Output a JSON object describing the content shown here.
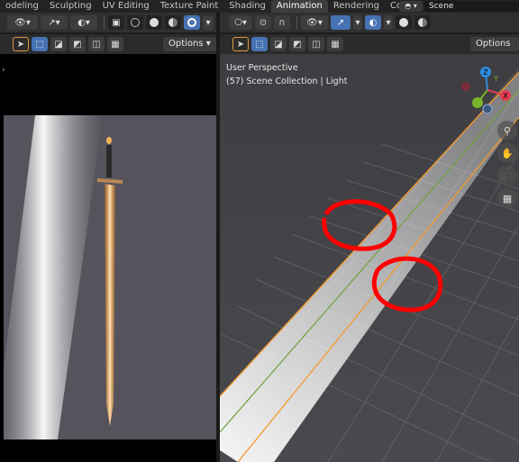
{
  "workspace_tabs": [
    {
      "label": "odeling",
      "active": false
    },
    {
      "label": "Sculpting",
      "active": false
    },
    {
      "label": "UV Editing",
      "active": false
    },
    {
      "label": "Texture Paint",
      "active": false
    },
    {
      "label": "Shading",
      "active": false
    },
    {
      "label": "Animation",
      "active": true
    },
    {
      "label": "Rendering",
      "active": false
    },
    {
      "label": "Com",
      "active": false
    }
  ],
  "scene": {
    "value": "Scene"
  },
  "left_editor": {
    "options_label": "Options"
  },
  "right_editor": {
    "options_label": "Options"
  },
  "viewport": {
    "perspective": "User Perspective",
    "collection": "(57) Scene Collection | Light",
    "gizmo": {
      "x_label": "X",
      "y_label": "Y",
      "z_label": "Z"
    }
  },
  "colors": {
    "accent_blue": "#4772b3",
    "annotation_red": "#ff0000",
    "axis_x": "#e33d50",
    "axis_y": "#7ab62a",
    "axis_z": "#2f8ce0",
    "selection_orange": "#f39a2c"
  }
}
